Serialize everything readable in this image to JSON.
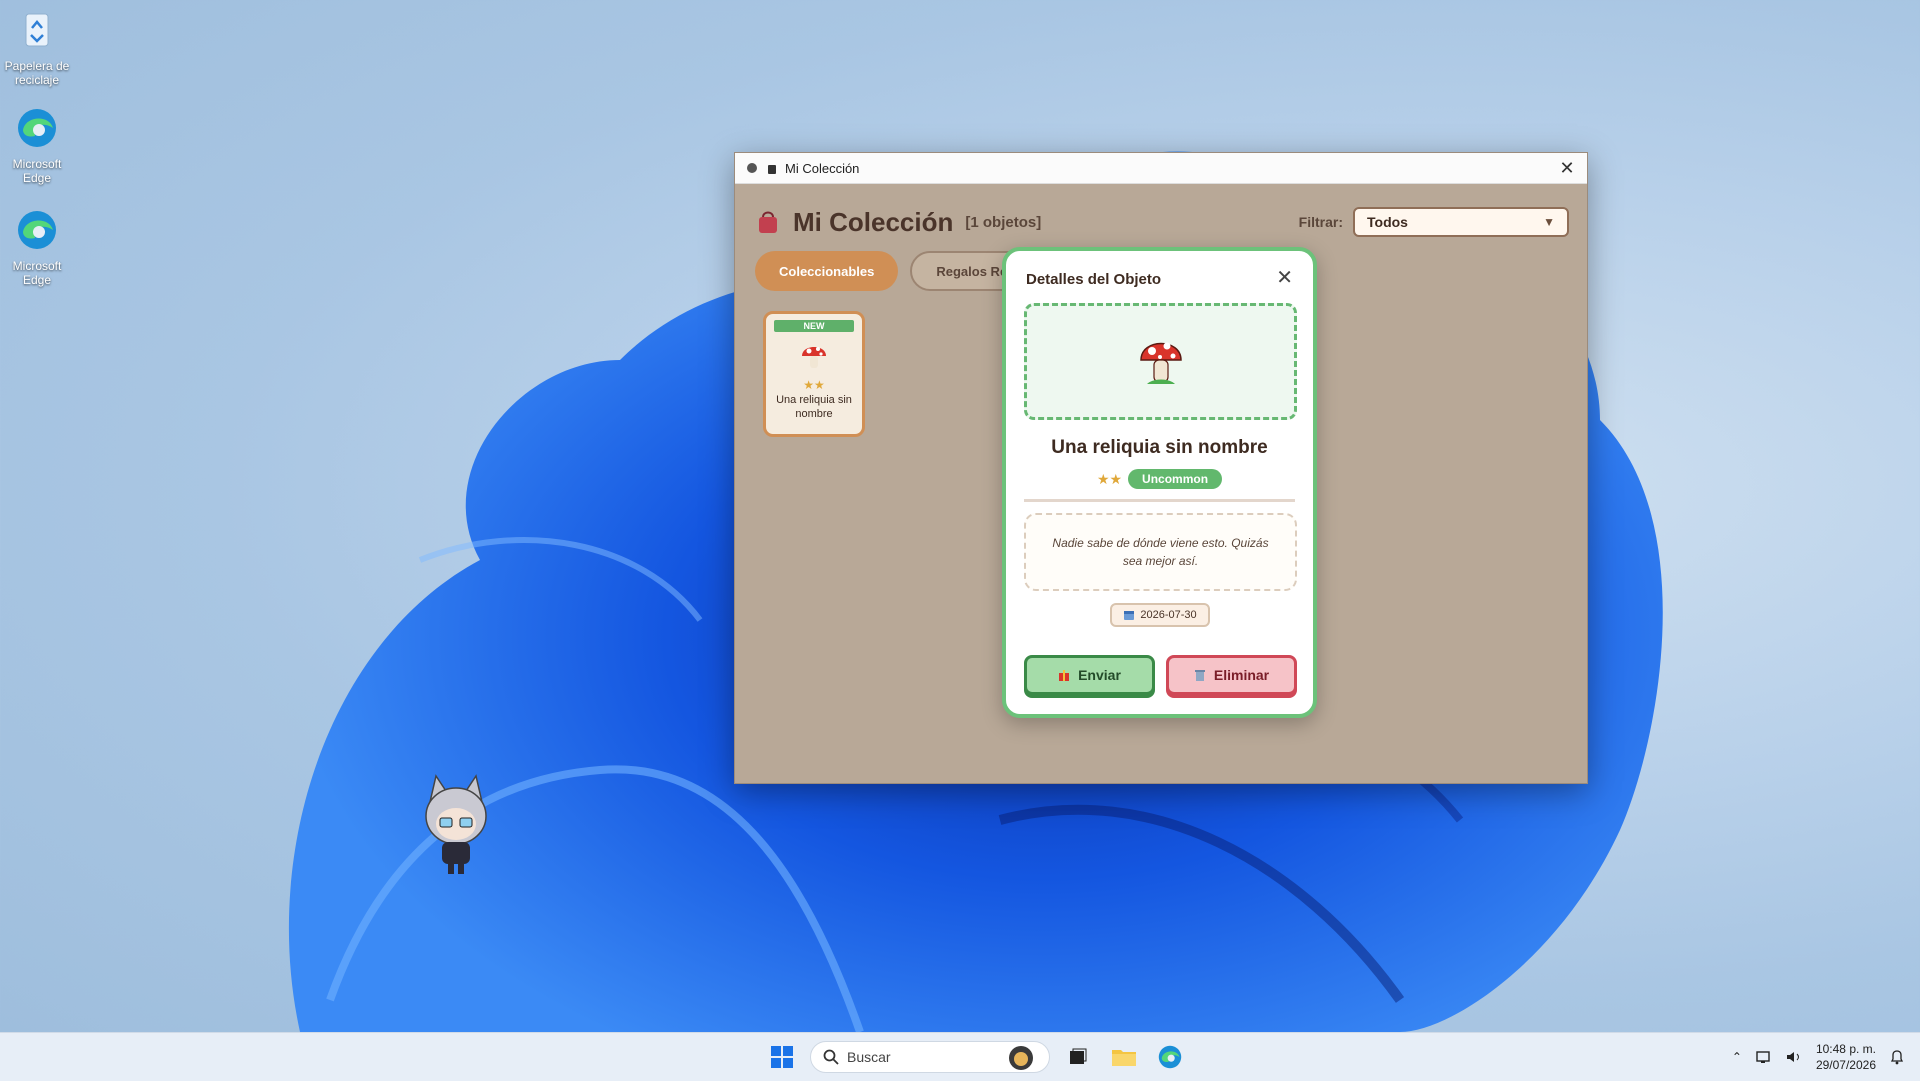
{
  "desktop": {
    "icons": [
      {
        "label": "Papelera de reciclaje",
        "icon": "recycle-bin-icon"
      },
      {
        "label": "Microsoft Edge",
        "icon": "edge-icon"
      },
      {
        "label": "Microsoft Edge",
        "icon": "edge-icon"
      }
    ]
  },
  "window": {
    "title": "Mi Colección",
    "header": {
      "title": "Mi Colección",
      "count": "[1 objetos]",
      "icon": "bag-icon"
    },
    "filter": {
      "label": "Filtrar:",
      "selected": "Todos"
    },
    "tabs": [
      {
        "label": "Coleccionables",
        "active": true
      },
      {
        "label": "Regalos Rec",
        "active": false
      }
    ],
    "items": [
      {
        "badge": "NEW",
        "stars": "★★",
        "name": "Una reliquia sin nombre",
        "icon": "mushroom-icon"
      }
    ]
  },
  "modal": {
    "title": "Detalles del Objeto",
    "item_name": "Una reliquia sin nombre",
    "stars": "★★",
    "rarity": "Uncommon",
    "description": "Nadie sabe de dónde viene esto. Quizás sea mejor así.",
    "date": "2026-07-30",
    "send_label": "Enviar",
    "delete_label": "Eliminar",
    "colors": {
      "accent_green": "#6cc27a",
      "danger": "#d04857",
      "brown": "#b8a897"
    }
  },
  "taskbar": {
    "search_placeholder": "Buscar",
    "time": "10:48 p. m.",
    "date": "29/07/2026"
  }
}
